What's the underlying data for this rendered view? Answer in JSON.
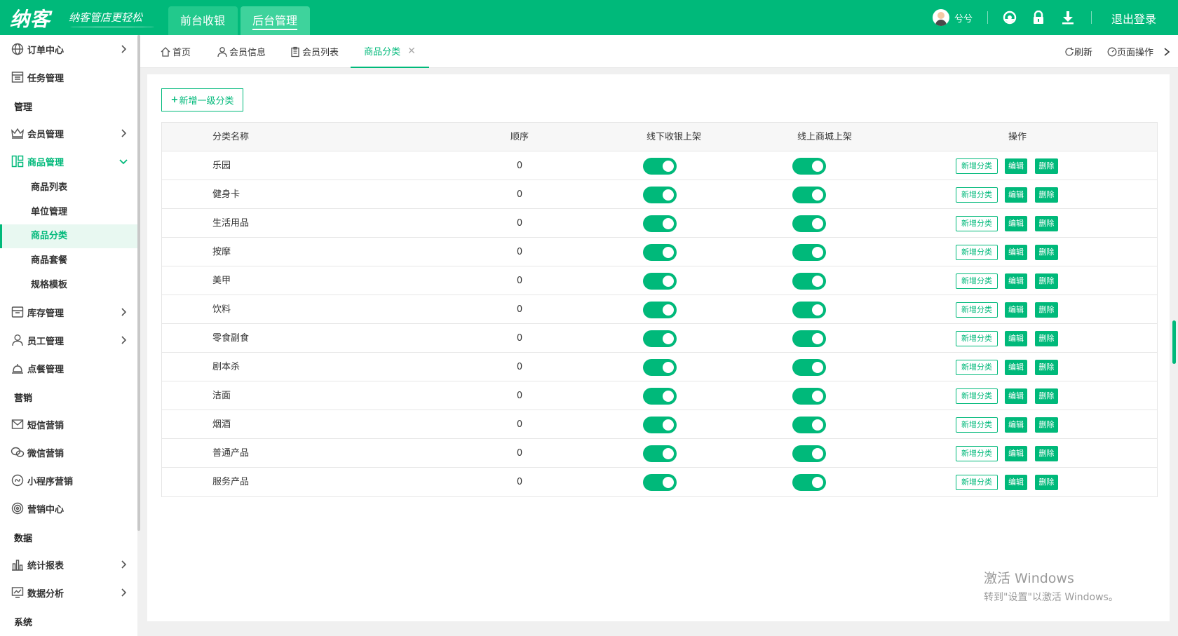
{
  "app": {
    "logo": "纳客",
    "slogan": "纳客管店更轻松",
    "nav_tabs": [
      {
        "label": "前台收银"
      },
      {
        "label": "后台管理"
      }
    ],
    "user_name": "兮兮",
    "logout_label": "退出登录"
  },
  "sidebar": {
    "items": [
      {
        "label": "订单中心",
        "icon": "globe-icon"
      },
      {
        "label": "任务管理",
        "icon": "task-icon"
      },
      {
        "label": "会员管理",
        "icon": "crown-icon"
      },
      {
        "label": "商品管理",
        "icon": "grid-icon"
      },
      {
        "label": "库存管理",
        "icon": "box-icon"
      },
      {
        "label": "员工管理",
        "icon": "user-icon"
      },
      {
        "label": "点餐管理",
        "icon": "bell-icon"
      },
      {
        "label": "短信营销",
        "icon": "mail-icon"
      },
      {
        "label": "微信营销",
        "icon": "wechat-icon"
      },
      {
        "label": "小程序营销",
        "icon": "miniapp-icon"
      },
      {
        "label": "营销中心",
        "icon": "target-icon"
      },
      {
        "label": "统计报表",
        "icon": "bar-chart-icon"
      },
      {
        "label": "数据分析",
        "icon": "monitor-chart-icon"
      }
    ],
    "groups": [
      "管理",
      "营销",
      "数据",
      "系统"
    ],
    "sub_items": [
      "商品列表",
      "单位管理",
      "商品分类",
      "商品套餐",
      "规格模板"
    ]
  },
  "tabs": {
    "items": [
      {
        "label": "首页",
        "icon": "home-icon"
      },
      {
        "label": "会员信息",
        "icon": "user-icon"
      },
      {
        "label": "会员列表",
        "icon": "clipboard-icon"
      },
      {
        "label": "商品分类",
        "icon": ""
      }
    ],
    "refresh_label": "刷新",
    "page_ops_label": "页面操作"
  },
  "main": {
    "add_button": "新增一级分类",
    "headers": [
      "分类名称",
      "顺序",
      "线下收银上架",
      "线上商城上架",
      "操作"
    ],
    "op_labels": {
      "add": "新增分类",
      "edit": "编辑",
      "delete": "删除"
    },
    "rows": [
      {
        "name": "乐园",
        "order": "0",
        "offline": true,
        "online": true
      },
      {
        "name": "健身卡",
        "order": "0",
        "offline": true,
        "online": true
      },
      {
        "name": "生活用品",
        "order": "0",
        "offline": true,
        "online": true
      },
      {
        "name": "按摩",
        "order": "0",
        "offline": true,
        "online": true
      },
      {
        "name": "美甲",
        "order": "0",
        "offline": true,
        "online": true
      },
      {
        "name": "饮料",
        "order": "0",
        "offline": true,
        "online": true
      },
      {
        "name": "零食副食",
        "order": "0",
        "offline": true,
        "online": true
      },
      {
        "name": "剧本杀",
        "order": "0",
        "offline": true,
        "online": true
      },
      {
        "name": "洁面",
        "order": "0",
        "offline": true,
        "online": true
      },
      {
        "name": "烟酒",
        "order": "0",
        "offline": true,
        "online": true
      },
      {
        "name": "普通产品",
        "order": "0",
        "offline": true,
        "online": true
      },
      {
        "name": "服务产品",
        "order": "0",
        "offline": true,
        "online": true
      }
    ]
  },
  "watermark": {
    "line1": "激活 Windows",
    "line2": "转到\"设置\"以激活 Windows。"
  },
  "colors": {
    "accent": "#00b97a"
  }
}
